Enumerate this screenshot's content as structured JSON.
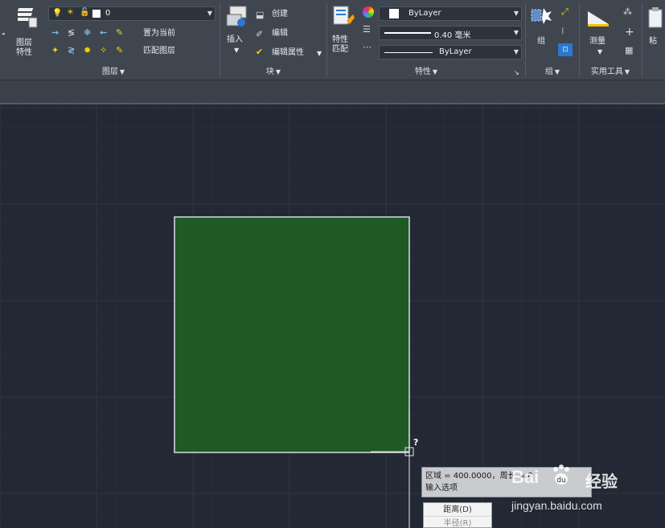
{
  "colors": {
    "ribbon_bg": "#3f4650",
    "canvas_bg": "#222834",
    "grid_major": "#2f3744",
    "grid_minor": "#272e39",
    "hatch_fill": "#1f5a24",
    "rect_border": "#d8dde2",
    "accent_blue": "#2a78d0"
  },
  "layers_panel": {
    "properties_label": "图层\n特性",
    "current_layer": "0",
    "set_current_label": "置为当前",
    "match_layer_label": "匹配图层",
    "title": "图层"
  },
  "block_panel": {
    "insert_label": "插入",
    "create_label": "创建",
    "edit_label": "编辑",
    "edit_attr_label": "编辑属性",
    "title": "块"
  },
  "properties_panel": {
    "match_label": "特性\n匹配",
    "color_value": "ByLayer",
    "lineweight_value": "0.40 毫米",
    "linetype_value": "ByLayer",
    "title": "特性"
  },
  "group_panel": {
    "group_label": "组",
    "title": "组"
  },
  "utilities_panel": {
    "measure_label": "测量",
    "title": "实用工具"
  },
  "clipboard_panel": {
    "paste_label": "粘"
  },
  "cursor_tooltip": {
    "question_mark": "?",
    "line1": "区域 = 400.0000，周长 = 8",
    "line2": "输入选项"
  },
  "options_menu": {
    "items": [
      "距离(D)",
      "半径(R)"
    ]
  },
  "watermark": {
    "brand": "Bai",
    "brand_cn": "经验",
    "url": "jingyan.baidu.com"
  }
}
